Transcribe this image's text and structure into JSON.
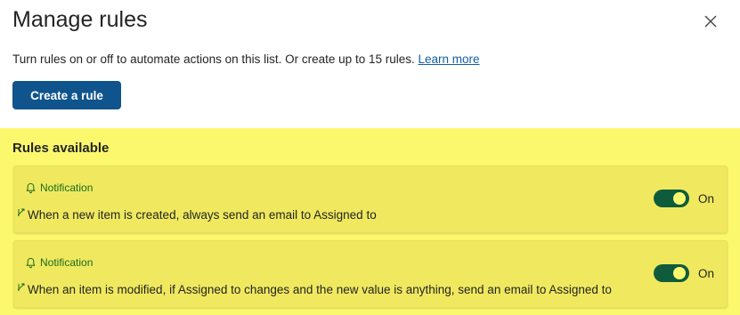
{
  "panel": {
    "title": "Manage rules",
    "close_icon": "close-icon"
  },
  "description": {
    "text": "Turn rules on or off to automate actions on this list. Or create up to 15 rules. ",
    "link": "Learn more"
  },
  "create_button": {
    "label": "Create a rule"
  },
  "rules_section": {
    "heading": "Rules available",
    "highlight_color": "#fbf86e",
    "rules": [
      {
        "category": "Notification",
        "category_icon": "bell-icon",
        "text": "When a new item is created, always send an email to Assigned to",
        "toggle_label": "On",
        "enabled": true
      },
      {
        "category": "Notification",
        "category_icon": "bell-icon",
        "text": "When an item is modified, if Assigned to changes and the new value is anything, send an email to Assigned to",
        "toggle_label": "On",
        "enabled": true
      }
    ]
  },
  "colors": {
    "accent": "#0f548c",
    "toggle_on": "#0e5c3c",
    "category_text": "#1c6b1e",
    "link": "#115ea3"
  }
}
